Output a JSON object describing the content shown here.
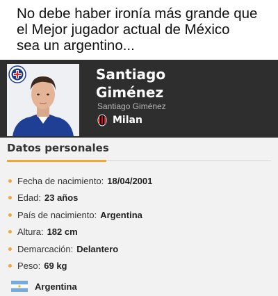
{
  "caption": {
    "lines": [
      "No debe haber ironía más grande que",
      "el Mejor jugador actual de México",
      "sea un argentino..."
    ]
  },
  "player": {
    "name_line1": "Santiago",
    "name_line2": "Giménez",
    "full_name": "Santiago Giménez",
    "club": "Milan",
    "club_crest_icon": "ac-milan-crest-icon",
    "former_club_crest_icon": "cruz-azul-crest-icon"
  },
  "personal": {
    "title": "Datos personales",
    "facts": [
      {
        "label": "Fecha de nacimiento:",
        "value": "18/04/2001"
      },
      {
        "label": "Edad:",
        "value": "23 años"
      },
      {
        "label": "País de nacimiento:",
        "value": "Argentina"
      },
      {
        "label": "Altura:",
        "value": "182 cm"
      },
      {
        "label": "Demarcación:",
        "value": "Delantero"
      },
      {
        "label": "Peso:",
        "value": "69 kg"
      }
    ],
    "nationality": "Argentina",
    "nationality_icon": "argentina-flag-icon"
  },
  "colors": {
    "header_bg": "#2e2e2e",
    "accent": "#f0a832",
    "panel_bg": "#f2f2f2"
  }
}
